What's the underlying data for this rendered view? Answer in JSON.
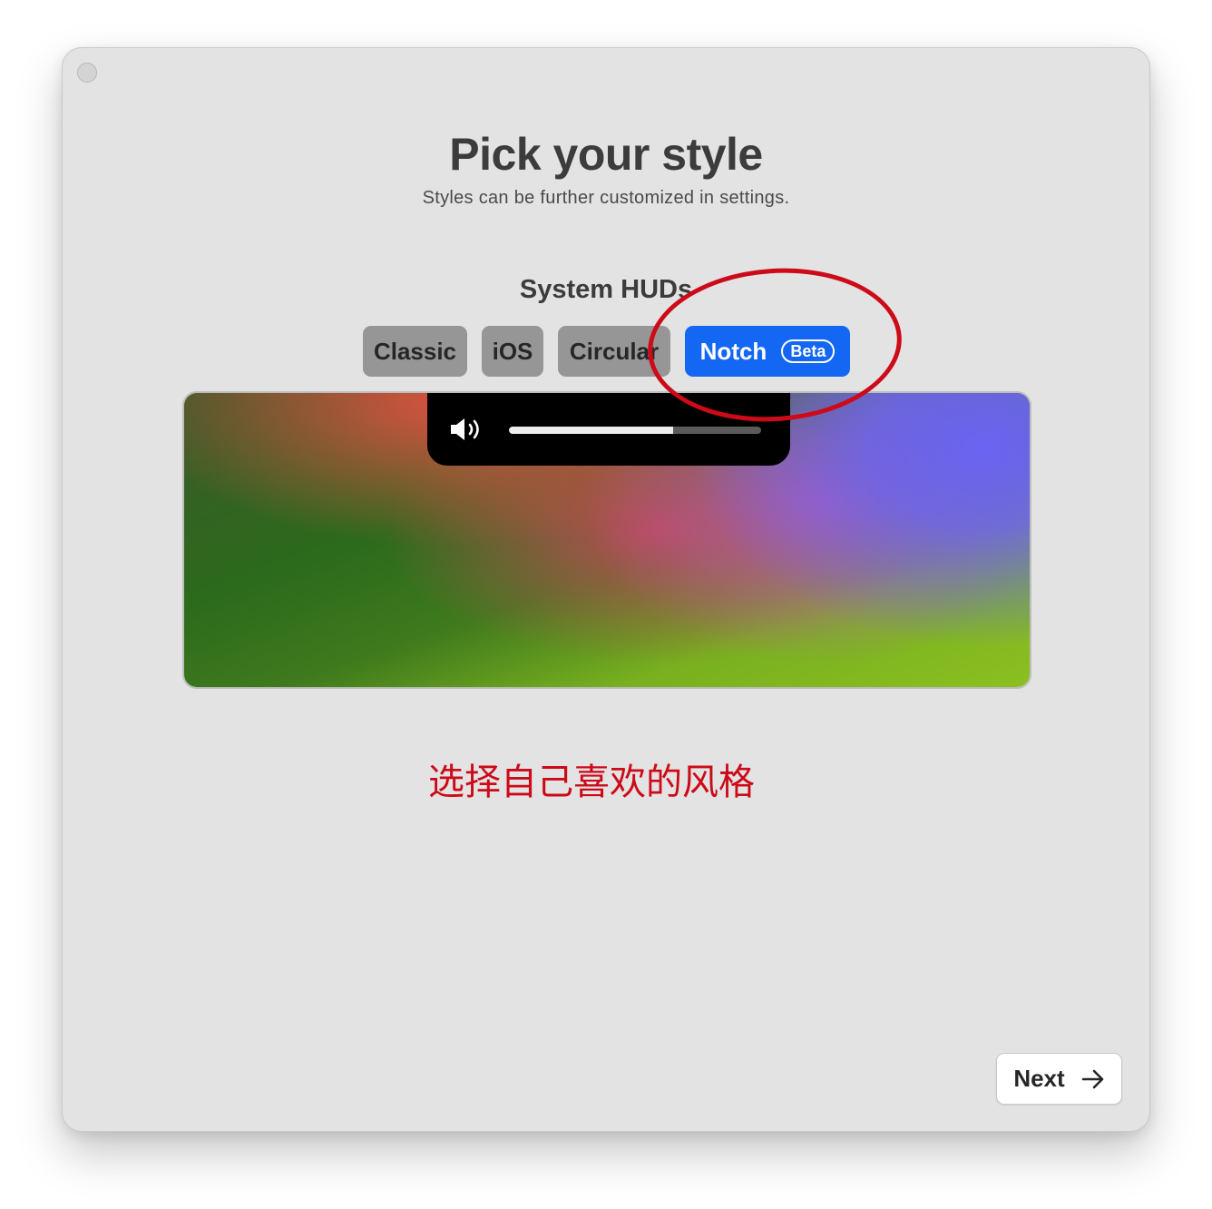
{
  "window": {
    "title": "Pick your style",
    "subtitle": "Styles can be further customized in settings."
  },
  "section": {
    "heading": "System HUDs"
  },
  "style_options": [
    {
      "label": "Classic",
      "selected": false
    },
    {
      "label": "iOS",
      "selected": false
    },
    {
      "label": "Circular",
      "selected": false
    },
    {
      "label": "Notch",
      "badge": "Beta",
      "selected": true
    }
  ],
  "preview": {
    "hud_type": "volume",
    "volume_icon": "speaker-wave-icon",
    "volume_level": 0.65
  },
  "annotation": {
    "text": "选择自己喜欢的风格",
    "color": "#cc0a18"
  },
  "footer": {
    "next_label": "Next",
    "next_icon": "arrow-right-icon"
  },
  "colors": {
    "accent": "#1467f3",
    "unselected_tab": "#969696",
    "window_bg": "#e3e3e3"
  }
}
